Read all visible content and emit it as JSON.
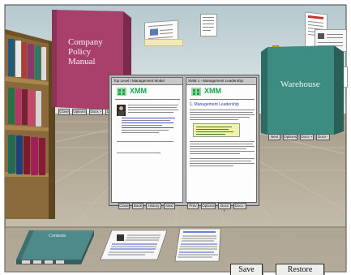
{
  "books": {
    "company_policy": {
      "title_line1": "Company",
      "title_line2": "Policy",
      "title_line3": "Manual",
      "buttons": [
        "Close",
        "Options",
        "Docs +",
        "Docs -"
      ]
    },
    "warehouse": {
      "title": "Warehouse",
      "buttons": [
        "Next",
        "Options",
        "Docs +",
        "Docs -"
      ]
    }
  },
  "left_doc": {
    "titlebar": "Top Level / Management Model",
    "logo": "XMM",
    "buttons": [
      "Close",
      "Back",
      "History",
      "Next"
    ]
  },
  "right_doc": {
    "titlebar": "XMM 1 - Management Leadership",
    "logo": "XMM",
    "heading": "1. Management Leadership",
    "buttons": [
      "Prev",
      "Options",
      "Docs +",
      "Docs -"
    ]
  },
  "floor_book": {
    "title": "Contents"
  },
  "actions": {
    "save": "Save",
    "restore": "Restore"
  },
  "colors": {
    "accent_pink": "#a9406b",
    "warehouse_teal": "#3d8c82",
    "floor_book_green": "#4f8a8a",
    "logo_green": "#16a34a"
  }
}
